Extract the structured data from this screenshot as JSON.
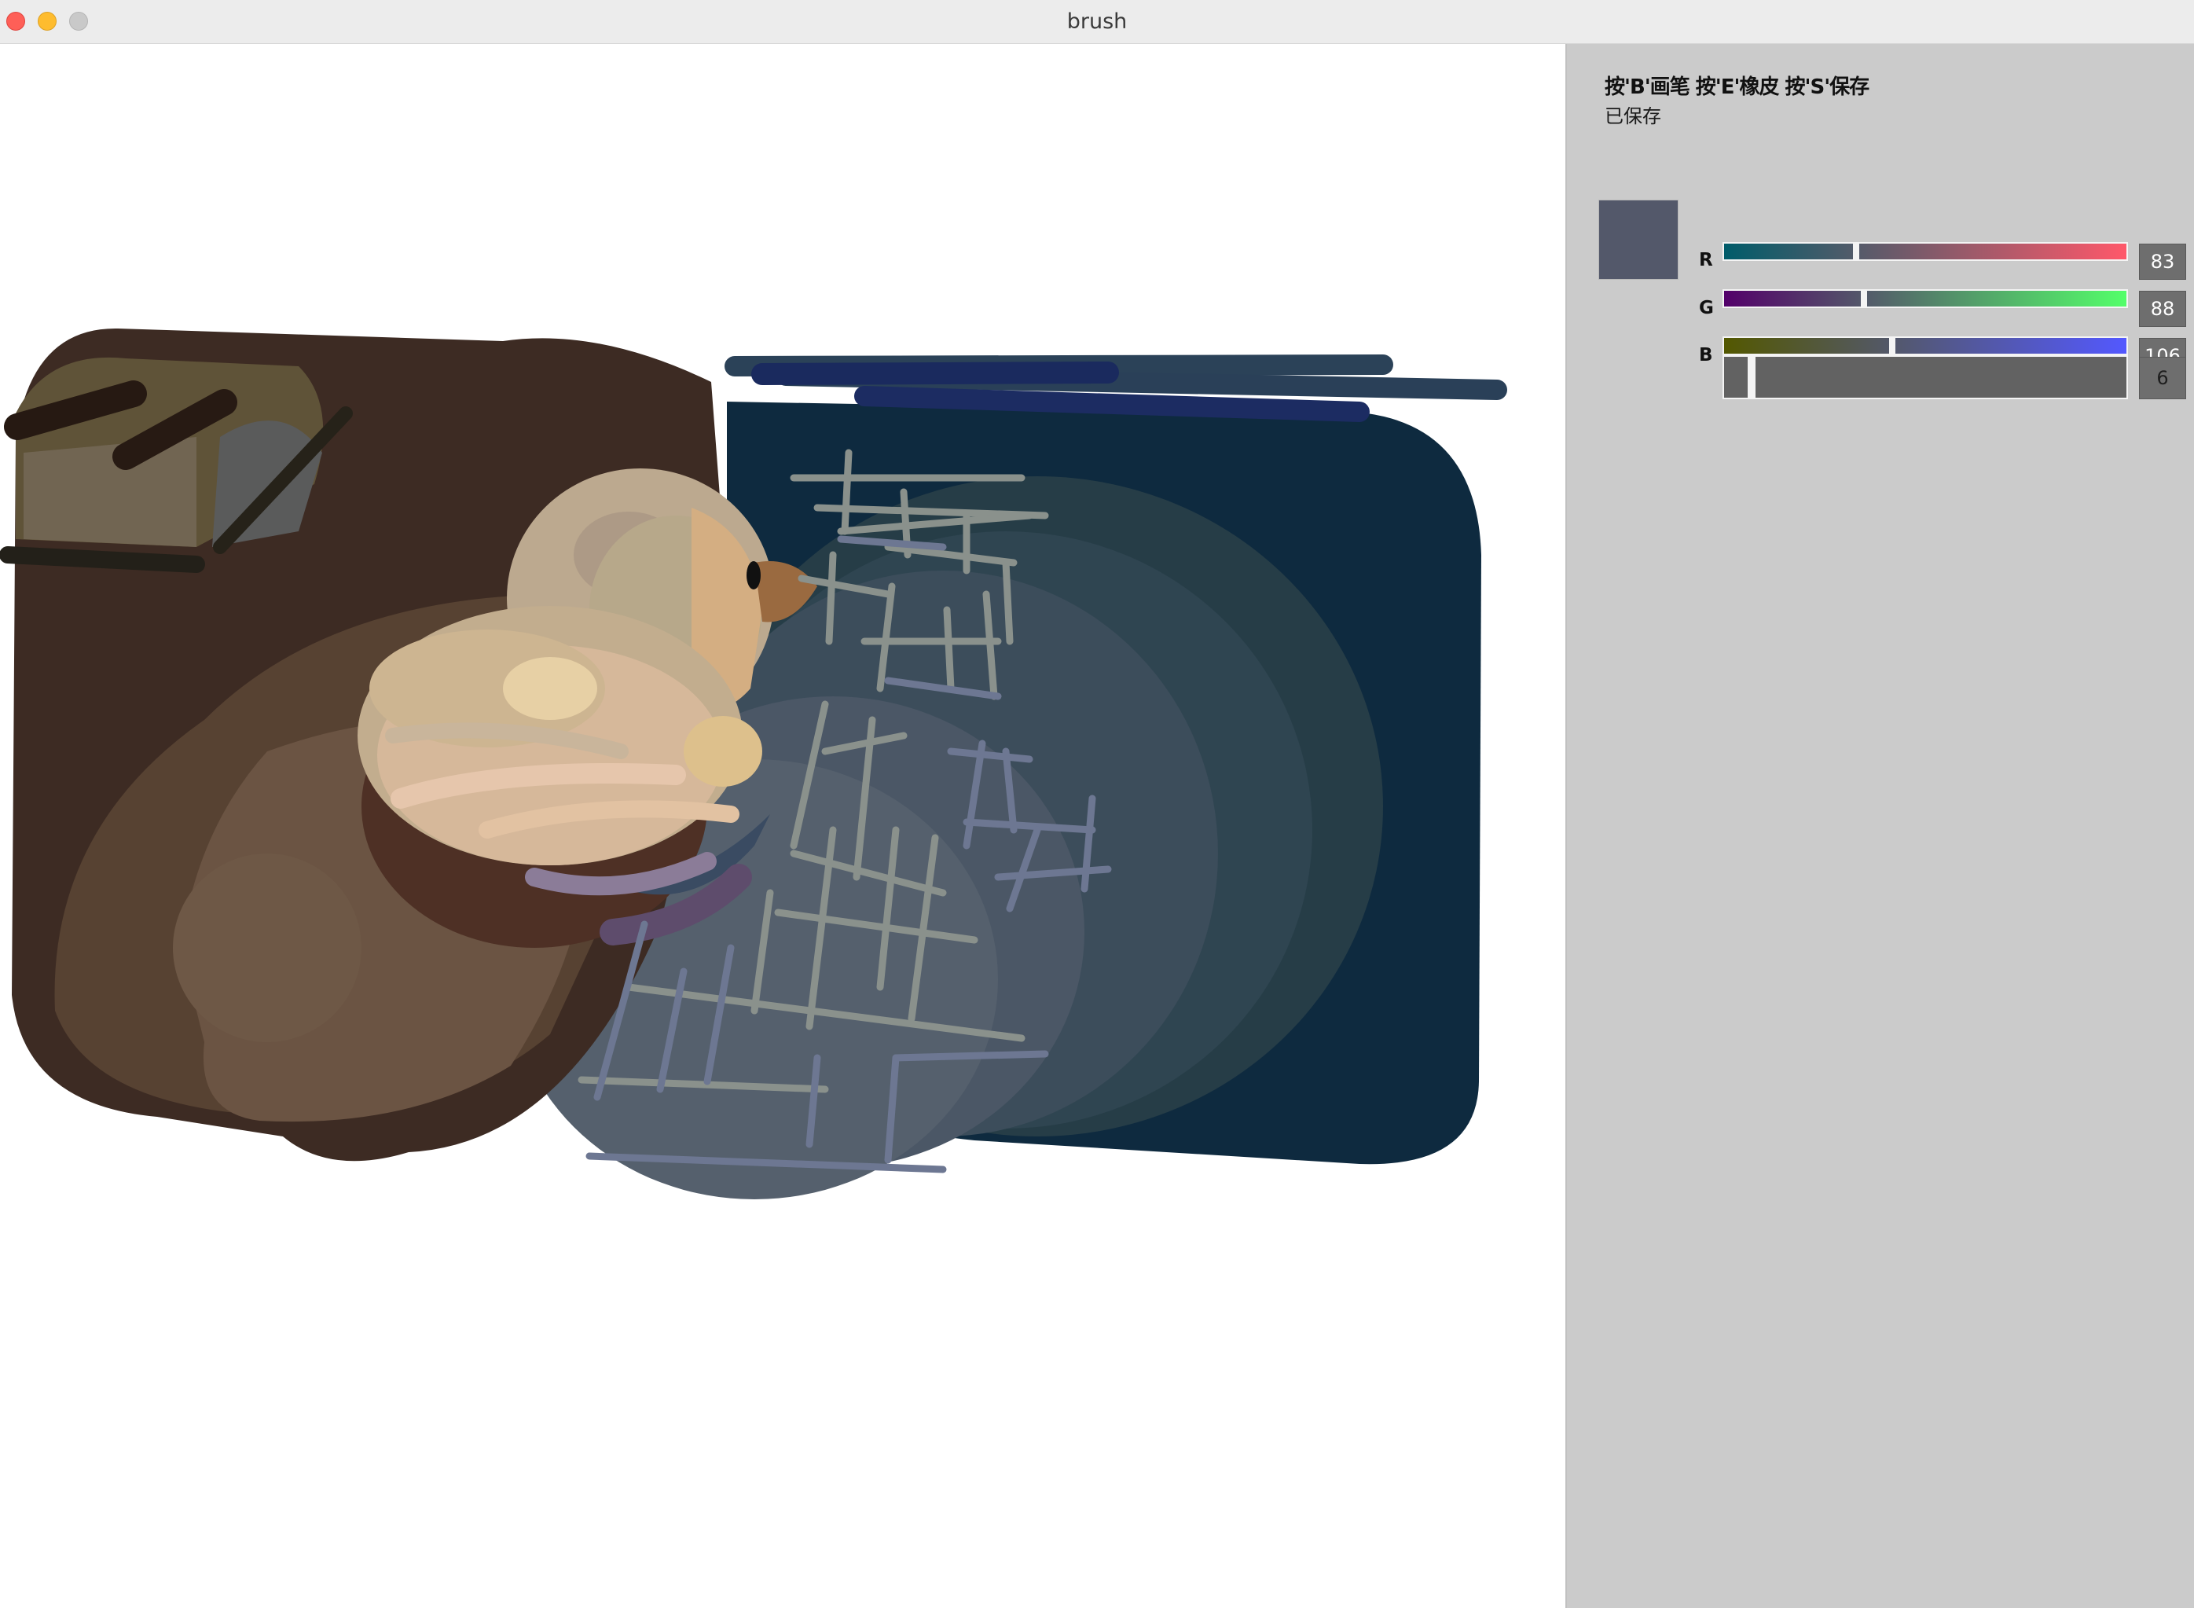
{
  "window": {
    "title": "brush"
  },
  "panel": {
    "hint": "按'B'画笔 按'E'橡皮 按'S'保存",
    "status": "已保存",
    "brush_color": "#53586a",
    "channels": [
      {
        "label": "R",
        "value": "83",
        "gradient": [
          "#005c6a",
          "#ff586a"
        ]
      },
      {
        "label": "G",
        "value": "88",
        "gradient": [
          "#5300 6a",
          "#53ff6a"
        ]
      },
      {
        "label": "B",
        "value": "106",
        "gradient": [
          "#535800",
          "#5358ff"
        ]
      }
    ],
    "brush_size": {
      "value": "6",
      "max": 100
    }
  }
}
